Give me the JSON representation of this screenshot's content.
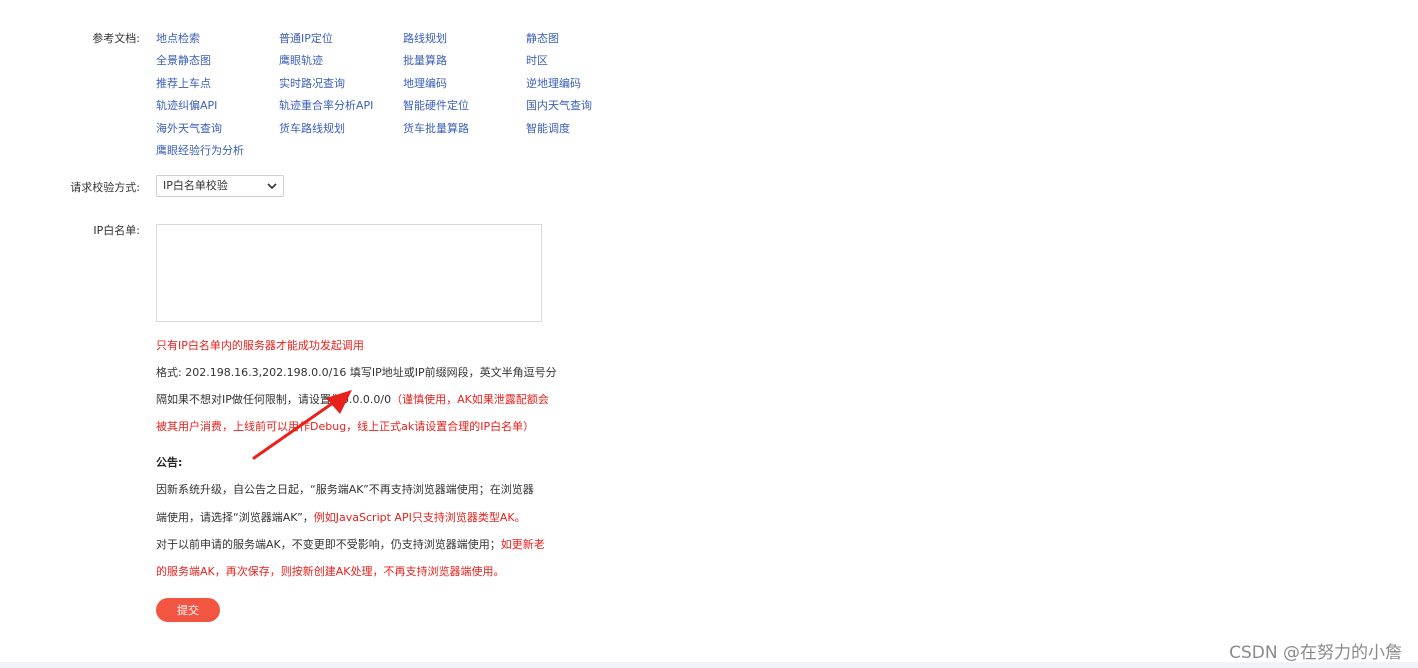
{
  "form": {
    "ref_docs_label": "参考文档:",
    "ref_docs": [
      [
        "地点检索",
        "普通IP定位",
        "路线规划",
        "静态图"
      ],
      [
        "全景静态图",
        "鹰眼轨迹",
        "批量算路",
        "时区"
      ],
      [
        "推荐上车点",
        "实时路况查询",
        "地理编码",
        "逆地理编码"
      ],
      [
        "轨迹纠偏API",
        "轨迹重合率分析API",
        "智能硬件定位",
        "国内天气查询"
      ],
      [
        "海外天气查询",
        "货车路线规划",
        "货车批量算路",
        "智能调度"
      ],
      [
        "鹰眼经验行为分析"
      ]
    ],
    "verify_label": "请求校验方式:",
    "verify_selected": "IP白名单校验",
    "whitelist_label": "IP白名单:",
    "whitelist_value": "",
    "hint_red": "只有IP白名单内的服务器才能成功发起调用",
    "format_line1": "格式: 202.198.16.3,202.198.0.0/16 填写IP地址或IP前缀网段，英文半角逗号分",
    "format_line2_dark": "隔如果不想对IP做任何限制，请设置为0.0.0.0/0",
    "format_line2_red": "（谨慎使用，AK如果泄露配额会",
    "format_line3_red": "被其用户消费，上线前可以用作Debug，线上正式ak请设置合理的IP白名单）",
    "notice_title": "公告:",
    "notice_line1": "因新系统升级，自公告之日起，“服务端AK”不再支持浏览器端使用；在浏览器",
    "notice_line2_dark": "端使用，请选择“浏览器端AK”，",
    "notice_line2_red": "例如JavaScript API只支持浏览器类型AK。",
    "notice_line3_dark": "对于以前申请的服务端AK，不变更即不受影响，仍支持浏览器端使用；",
    "notice_line3_red": "如更新老",
    "notice_line4_red": "的服务端AK，再次保存，则按新创建AK处理，不再支持浏览器端使用。",
    "submit_label": "提交"
  },
  "watermark": "CSDN @在努力的小詹",
  "colors": {
    "link": "#3b5fb8",
    "warning_red": "#e8211d",
    "submit_bg": "#f25643",
    "arrow": "#e8211d"
  }
}
